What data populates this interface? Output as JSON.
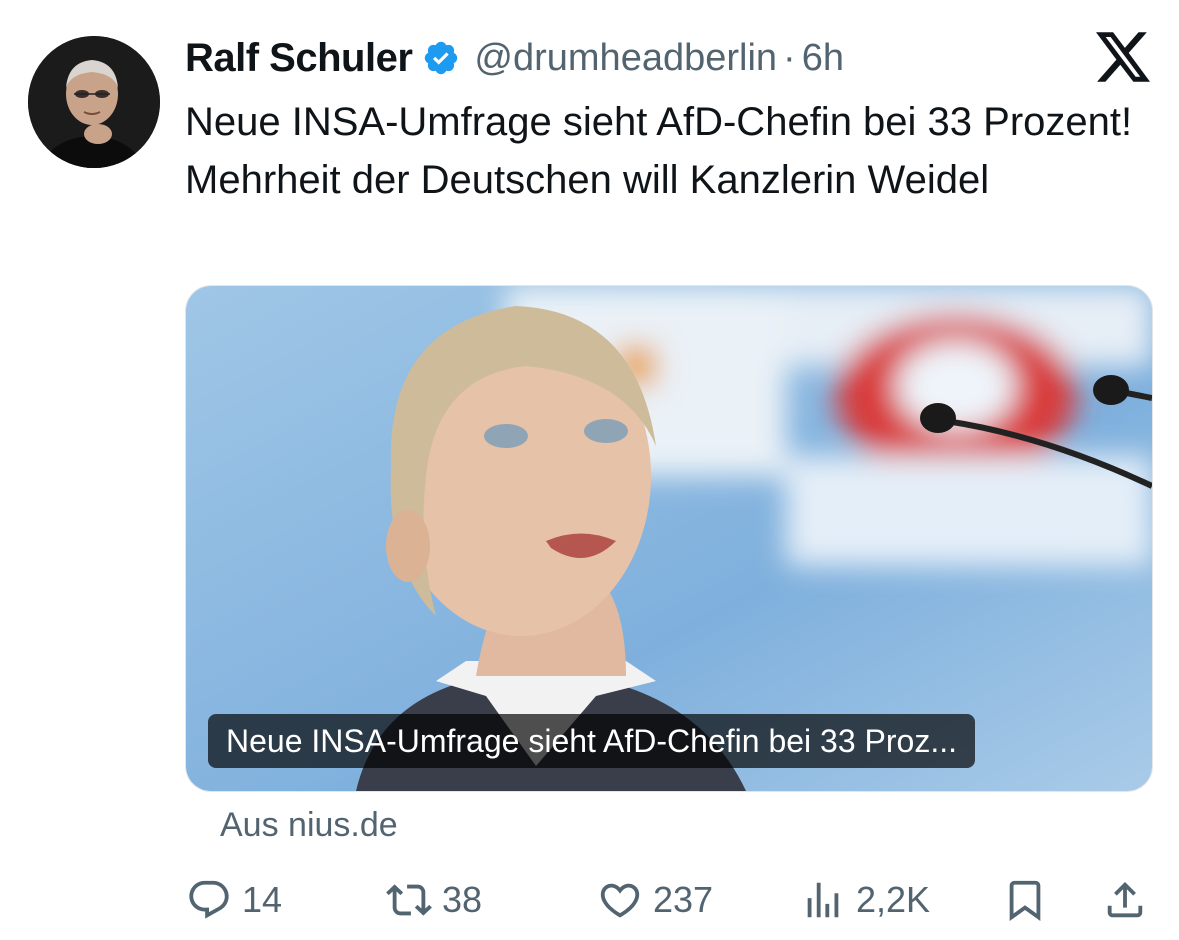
{
  "author": {
    "name": "Ralf Schuler",
    "handle": "@drumheadberlin",
    "separator": "·",
    "time": "6h",
    "verified": true
  },
  "tweet": {
    "text": "Neue INSA-Umfrage sieht AfD-Chefin bei 33 Prozent! Mehrheit der Deutschen will Kanzlerin Weidel"
  },
  "card": {
    "title": "Neue INSA-Umfrage sieht AfD-Chefin bei 33 Proz...",
    "source": "Aus nius.de"
  },
  "actions": {
    "replies": "14",
    "retweets": "38",
    "likes": "237",
    "views": "2,2K"
  },
  "icons": {
    "verified": "verified-badge-icon",
    "logo": "x-logo-icon",
    "reply": "reply-icon",
    "retweet": "retweet-icon",
    "like": "heart-icon",
    "views": "views-icon",
    "bookmark": "bookmark-icon",
    "share": "share-icon"
  },
  "colors": {
    "verified": "#1d9bf0",
    "text": "#0f1419",
    "secondary": "#536471"
  }
}
